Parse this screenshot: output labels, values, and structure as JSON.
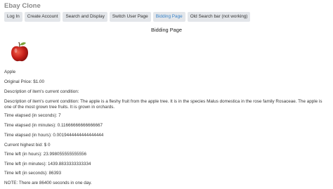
{
  "header": {
    "brand": "Ebay Clone"
  },
  "nav": {
    "items": [
      {
        "label": "Log In"
      },
      {
        "label": "Create Account"
      },
      {
        "label": "Search and Display"
      },
      {
        "label": "Switch User Page"
      },
      {
        "label": "Bidding Page",
        "active": true
      },
      {
        "label": "Old Search bar (not working)"
      }
    ]
  },
  "page": {
    "title": "Bidding Page",
    "item_icon": "red-apple-icon",
    "item_name": "Apple",
    "original_price": "Original Price: $1.00",
    "condition_label": "Description of item's current condition:",
    "description": "Description of item's current condition: The apple is a fleshy fruit from the apple tree. It is in the species Malus domestica in the rose family Rosaceae. The apple is one of the most grown tree fruits. It is grown in orchards.",
    "elapsed_seconds": "Time elapsed (in seconds): 7",
    "elapsed_minutes": "Time elapsed (in minutes): 0.11666666666666667",
    "elapsed_hours": "Time elapsed (in hours): 0.0019444444444444444",
    "highest_bid": "Current highest bid: $ 0",
    "left_hours": "Time left (in hours): 23.998055555555556",
    "left_minutes": "Time left (in minutes): 1439.8833333333334",
    "left_seconds": "Time left (in seconds): 86393",
    "note": "NOTE: There are 86400 seconds in one day."
  },
  "colors": {
    "accent": "#3a84c9",
    "nav_bg": "#e3e6ea",
    "brand": "#8a8a8a"
  }
}
